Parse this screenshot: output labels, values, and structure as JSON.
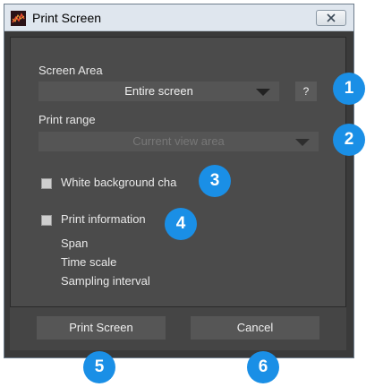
{
  "window": {
    "title": "Print Screen"
  },
  "screen_area": {
    "label": "Screen Area",
    "selected": "Entire screen",
    "help_label": "?"
  },
  "print_range": {
    "label": "Print range",
    "selected": "Current view area"
  },
  "options": {
    "white_background": {
      "label": "White background cha",
      "checked": false
    },
    "print_information": {
      "label": "Print information",
      "checked": false
    },
    "info_items": [
      "Span",
      "Time scale",
      "Sampling interval"
    ]
  },
  "buttons": {
    "print": "Print Screen",
    "cancel": "Cancel"
  },
  "callouts": [
    "1",
    "2",
    "3",
    "4",
    "5",
    "6"
  ],
  "colors": {
    "dialog_bg": "#4b4b4b",
    "footer_bg": "#454545",
    "callout": "#1a8fe6",
    "titlebar": "#dfe6ee"
  }
}
